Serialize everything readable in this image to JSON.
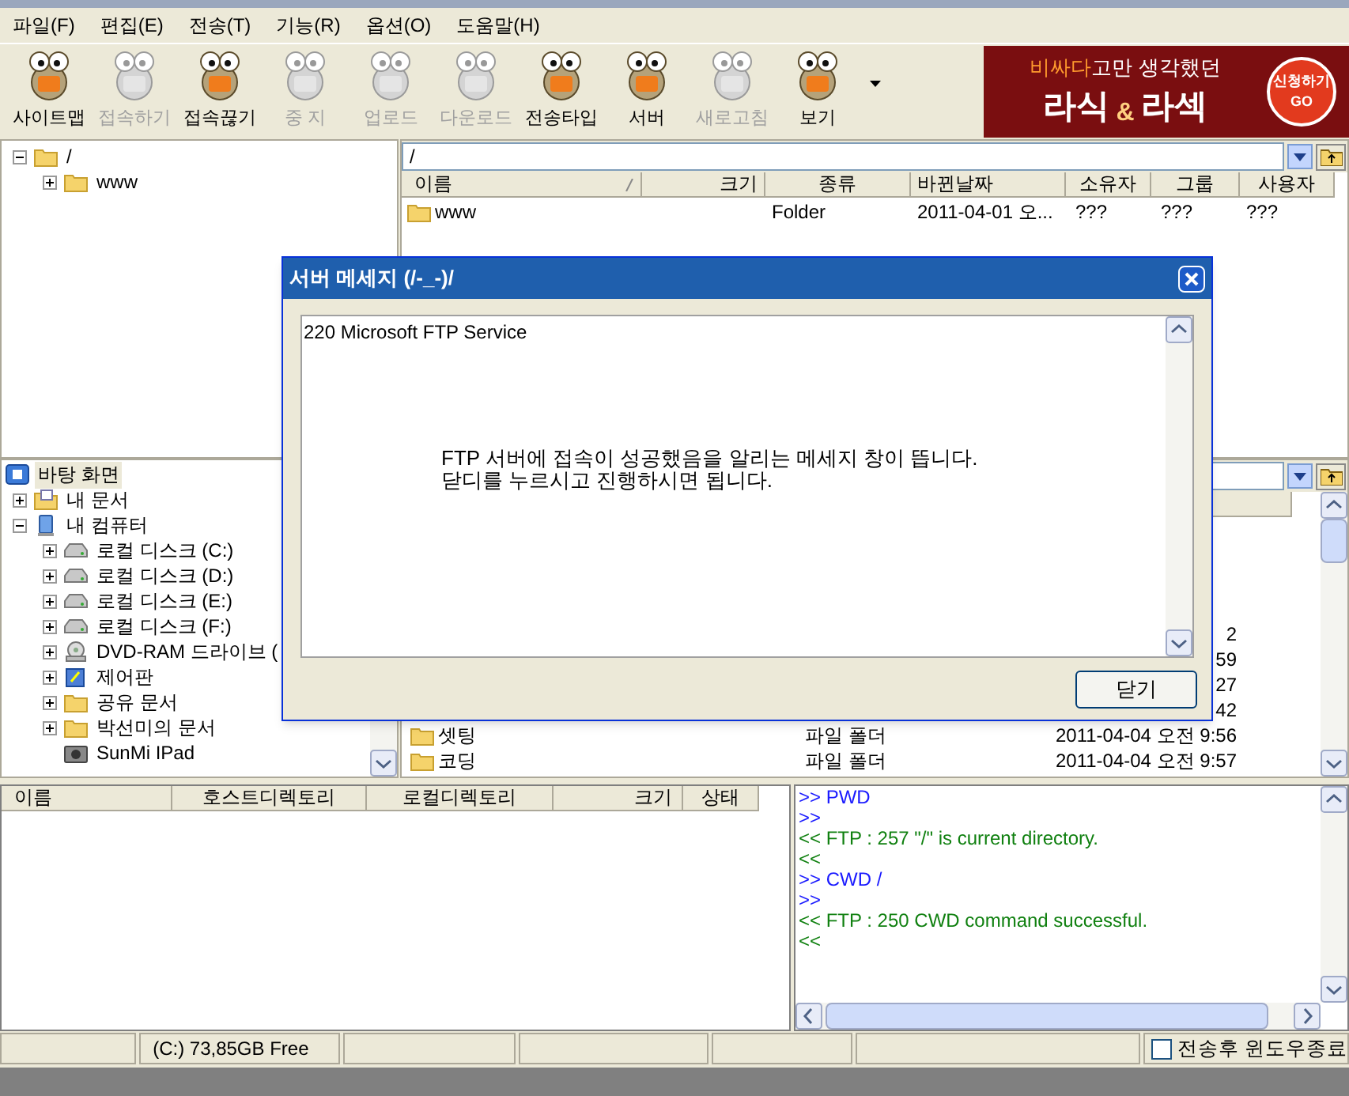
{
  "menu": [
    "파일(F)",
    "편집(E)",
    "전송(T)",
    "기능(R)",
    "옵션(O)",
    "도움말(H)"
  ],
  "toolbar": [
    {
      "label": "사이트맵",
      "disabled": false
    },
    {
      "label": "접속하기",
      "disabled": true
    },
    {
      "label": "접속끊기",
      "disabled": false
    },
    {
      "label": "중 지",
      "disabled": true
    },
    {
      "label": "업로드",
      "disabled": true
    },
    {
      "label": "다운로드",
      "disabled": true
    },
    {
      "label": "전송타입",
      "disabled": false
    },
    {
      "label": "서버",
      "disabled": false
    },
    {
      "label": "새로고침",
      "disabled": true
    },
    {
      "label": "보기",
      "disabled": false
    }
  ],
  "ad_banner": {
    "line_1_highlight": "비싸다",
    "line_1": "고만 생각했던",
    "headline_1": "라식",
    "headline_amp": "&",
    "headline_2": "라섹",
    "button_label": "신청하기",
    "button_sub": "GO"
  },
  "remote_tree": [
    {
      "label": "/",
      "kind": "folder",
      "expanded": true,
      "selected": false,
      "children": [
        {
          "label": "www",
          "kind": "folder",
          "expanded": false,
          "selected": false
        }
      ]
    }
  ],
  "remote_list": {
    "path": "/",
    "columns": [
      "이름",
      "크기",
      "종류",
      "바뀐날짜",
      "소유자",
      "그룹",
      "사용자"
    ],
    "rows": [
      {
        "name": "www",
        "type": "Folder",
        "date": "2011-04-01 오...",
        "owner": "???",
        "group": "???",
        "user": "???"
      }
    ]
  },
  "local_tree": [
    {
      "label": "바탕 화면",
      "kind": "desktop",
      "selected": true,
      "children": [
        {
          "label": "내 문서",
          "kind": "documents",
          "expanded": false,
          "selected": false
        },
        {
          "label": "내 컴퓨터",
          "kind": "computer",
          "expanded": true,
          "selected": false,
          "children": [
            {
              "label": "로컬 디스크 (C:)",
              "kind": "drive",
              "expanded": false,
              "selected": false
            },
            {
              "label": "로컬 디스크 (D:)",
              "kind": "drive",
              "expanded": false,
              "selected": false
            },
            {
              "label": "로컬 디스크 (E:)",
              "kind": "drive",
              "expanded": false,
              "selected": false
            },
            {
              "label": "로컬 디스크 (F:)",
              "kind": "drive",
              "expanded": false,
              "selected": false
            },
            {
              "label": "DVD-RAM 드라이브 (",
              "kind": "dvd",
              "expanded": false,
              "selected": false
            },
            {
              "label": "제어판",
              "kind": "control_panel",
              "expanded": false,
              "selected": false
            },
            {
              "label": "공유 문서",
              "kind": "folder",
              "expanded": false,
              "selected": false
            },
            {
              "label": "박선미의 문서",
              "kind": "folder",
              "expanded": false,
              "selected": false
            },
            {
              "label": "SunMi IPad",
              "kind": "device",
              "selected": false
            }
          ]
        }
      ]
    }
  ],
  "local_list": {
    "rows": [
      {
        "date": "2"
      },
      {
        "date": "59"
      },
      {
        "date": "27"
      },
      {
        "date": "42"
      },
      {
        "name": "셋팅",
        "type": "파일 폴더",
        "date": "2011-04-04 오전 9:56"
      },
      {
        "name": "코딩",
        "type": "파일 폴더",
        "date": "2011-04-04 오전 9:57"
      }
    ]
  },
  "queue": {
    "columns": [
      "이름",
      "호스트디렉토리",
      "로컬디렉토리",
      "크기",
      "상태"
    ]
  },
  "log": [
    {
      "kind": "sent",
      "text": ">> PWD"
    },
    {
      "kind": "sent",
      "text": ">>"
    },
    {
      "kind": "received",
      "text": "<< FTP : 257 \"/\" is current directory."
    },
    {
      "kind": "received",
      "text": "<<"
    },
    {
      "kind": "sent",
      "text": ">> CWD /"
    },
    {
      "kind": "sent",
      "text": ">>"
    },
    {
      "kind": "received",
      "text": "<< FTP : 250 CWD command successful."
    },
    {
      "kind": "received",
      "text": "<<"
    }
  ],
  "status_bar": {
    "drive_free": "(C:)  73,85GB Free",
    "shutdown_option": {
      "label": "전송후 윈도우종료",
      "checked": false
    }
  },
  "dialog": {
    "title": "서버 메세지 (/-_-)/",
    "first_line": "220 Microsoft FTP Service",
    "message_lines": [
      "FTP 서버에 접속이 성공했음을 알리는 메세지 창이 뜹니다.",
      "닫디를 누르시고 진행하시면 됩니다."
    ],
    "close_button": "닫기"
  }
}
